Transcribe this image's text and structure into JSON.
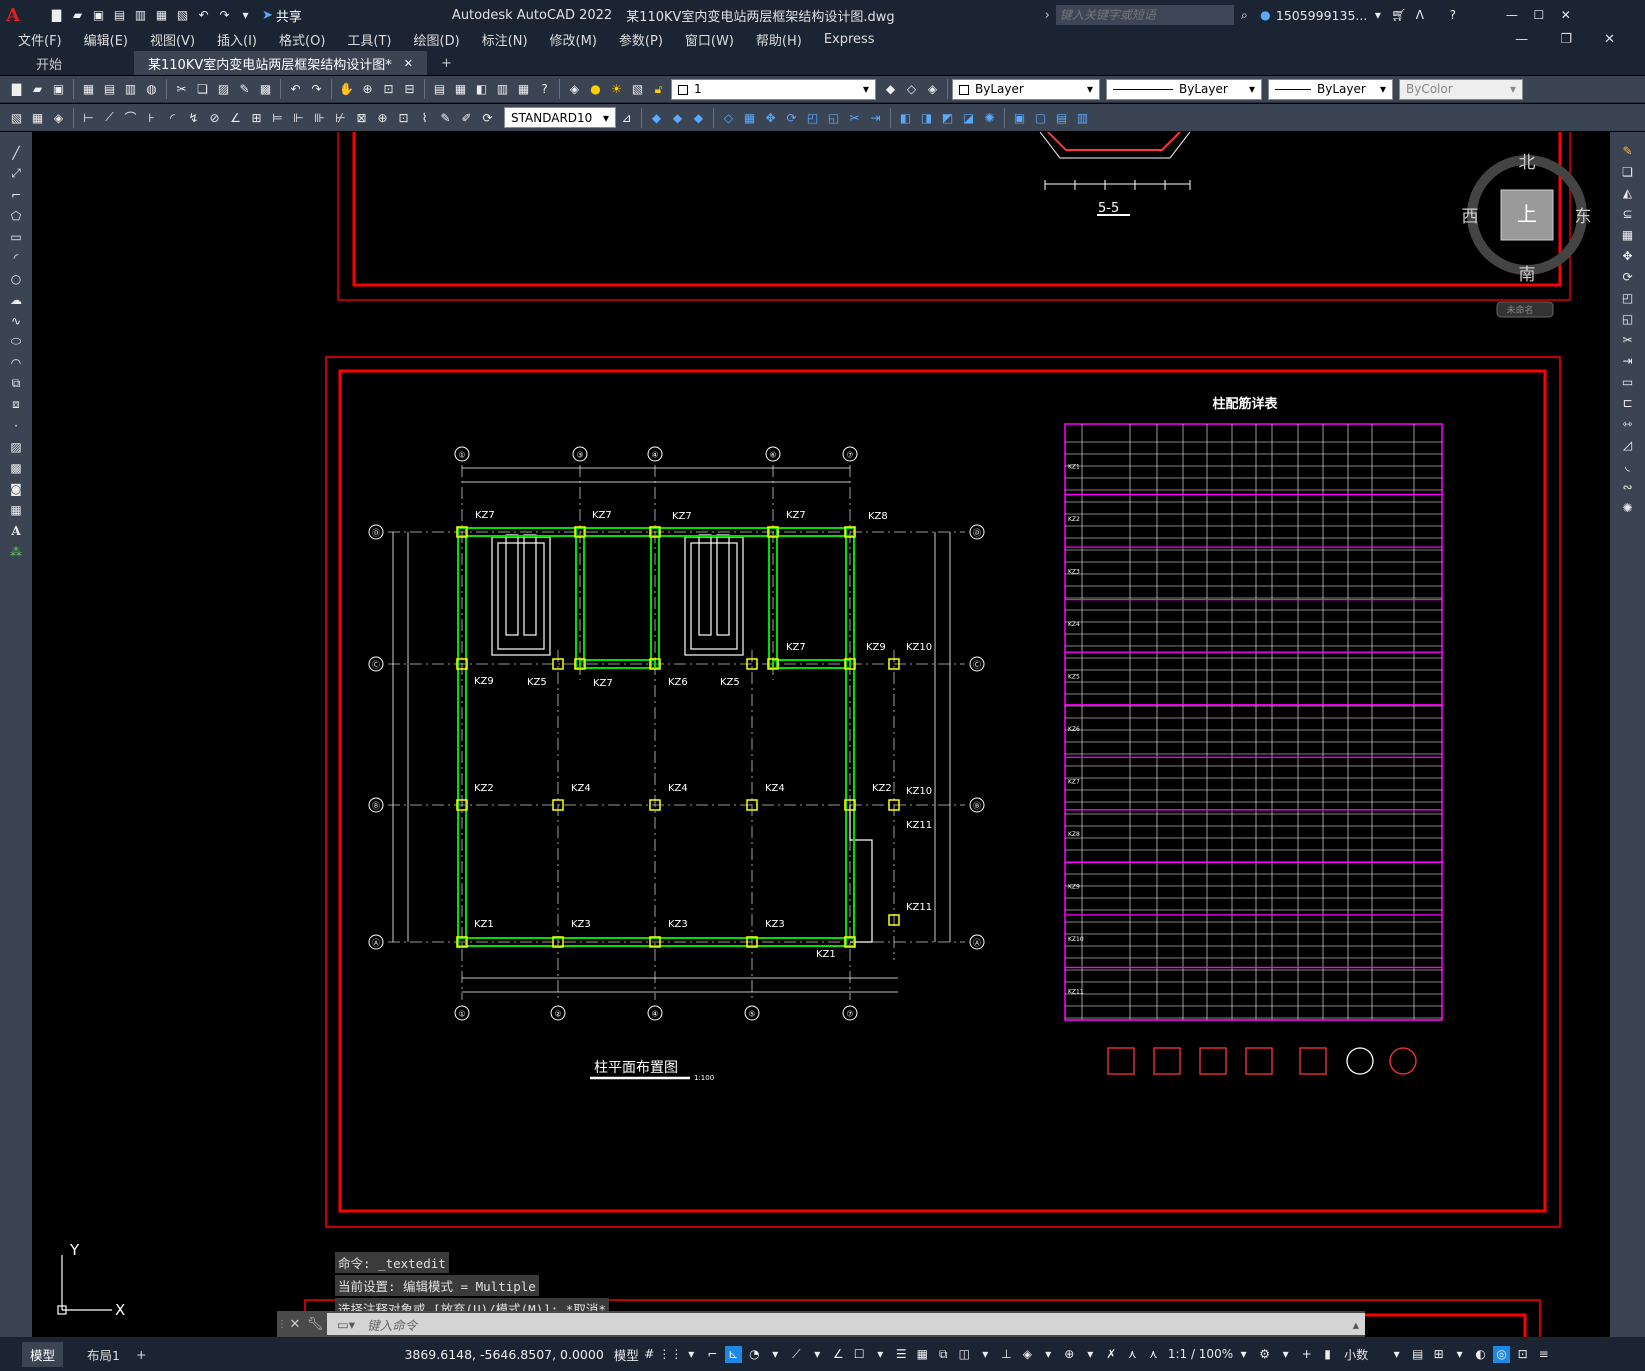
{
  "title": {
    "app": "Autodesk AutoCAD 2022",
    "file": "某110KV室内变电站两层框架结构设计图.dwg",
    "share": "共享",
    "search_placeholder": "键入关键字或短语",
    "user": "1505999135..."
  },
  "menu": [
    "文件(F)",
    "编辑(E)",
    "视图(V)",
    "插入(I)",
    "格式(O)",
    "工具(T)",
    "绘图(D)",
    "标注(N)",
    "修改(M)",
    "参数(P)",
    "窗口(W)",
    "帮助(H)",
    "Express"
  ],
  "tabs": {
    "start": "开始",
    "doc": "某110KV室内变电站两层框架结构设计图*",
    "close": "✕",
    "add": "+"
  },
  "props": {
    "layer": "1",
    "color": "ByLayer",
    "linetype": "ByLayer",
    "lineweight": "ByLayer",
    "plotstyle": "ByColor",
    "textstyle": "STANDARD10"
  },
  "viewcube": {
    "n": "北",
    "s": "南",
    "e": "东",
    "w": "西",
    "top": "上",
    "ucs": "未命名"
  },
  "drawing": {
    "section_label": "5-5",
    "plan_title": "柱平面布置图",
    "plan_scale": "1:100",
    "table_title": "柱配筋详表",
    "top_axes": [
      "①",
      "③",
      "④",
      "⑥",
      "⑦"
    ],
    "bottom_axes": [
      "①",
      "②",
      "④",
      "⑤",
      "⑦"
    ],
    "rows": [
      "Ⓓ",
      "Ⓒ",
      "Ⓑ",
      "Ⓐ"
    ],
    "row_D": [
      "KZ7",
      "KZ7",
      "KZ7",
      "KZ7",
      "KZ8"
    ],
    "row_C_top": [
      "KZ7",
      "KZ9",
      "KZ10"
    ],
    "row_C_bottom": [
      "KZ9",
      "KZ5",
      "KZ7",
      "KZ6",
      "KZ5"
    ],
    "row_B": [
      "KZ2",
      "KZ4",
      "KZ4",
      "KZ4",
      "KZ2",
      "KZ10",
      "KZ11"
    ],
    "row_A": [
      "KZ1",
      "KZ3",
      "KZ3",
      "KZ3",
      "KZ1",
      "KZ11"
    ],
    "table_groups": [
      "KZ1",
      "KZ2",
      "KZ3",
      "KZ4",
      "KZ5",
      "KZ6",
      "KZ7",
      "KZ8",
      "KZ9",
      "KZ10",
      "KZ11"
    ]
  },
  "ucs": {
    "x": "X",
    "y": "Y"
  },
  "command": {
    "history": [
      "命令: _textedit",
      "当前设置: 编辑模式 = Multiple",
      "选择注释对象或 [放弃(U)/模式(M)]: *取消*"
    ],
    "placeholder": "键入命令"
  },
  "status": {
    "model_tab": "模型",
    "layout_tab": "布局1",
    "add": "+",
    "coords": "3869.6148, -5646.8507, 0.0000",
    "space": "模型",
    "scale": "1:1 / 100%",
    "units": "小数"
  },
  "colors": {
    "accent": "#1e88e5",
    "frame": "#ff0000",
    "column": "#ffff00",
    "beam": "#00ff00",
    "table": "#ff00ff"
  }
}
